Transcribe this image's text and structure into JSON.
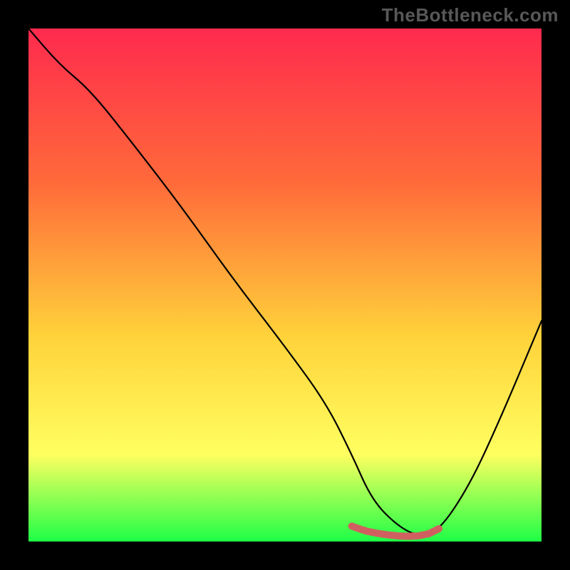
{
  "watermark": "TheBottleneck.com",
  "colors": {
    "frame": "#000000",
    "gradient_top": "#ff2a4e",
    "gradient_mid1": "#ff6a3a",
    "gradient_mid2": "#ffd23a",
    "gradient_mid3": "#ffff60",
    "gradient_bottom": "#1eff46",
    "curve": "#000000",
    "marker": "#d06060"
  },
  "chart_data": {
    "type": "line",
    "title": "",
    "xlabel": "",
    "ylabel": "",
    "xlim": [
      0,
      100
    ],
    "ylim": [
      0,
      100
    ],
    "series": [
      {
        "name": "bottleneck-curve",
        "x": [
          0,
          6,
          12,
          20,
          30,
          40,
          50,
          58,
          63,
          67,
          72,
          76,
          80,
          86,
          92,
          100
        ],
        "y": [
          100,
          93,
          88,
          78,
          65,
          51,
          38,
          27,
          17,
          8,
          3,
          1,
          2,
          11,
          24,
          43
        ]
      }
    ],
    "annotations": [
      {
        "name": "bottleneck-valley-marker",
        "x": [
          63,
          65,
          66,
          68,
          70,
          72,
          74,
          76,
          78,
          80
        ],
        "y": [
          3,
          2.3,
          2.0,
          1.6,
          1.3,
          1.1,
          1.0,
          1.1,
          1.5,
          2.5
        ]
      }
    ]
  }
}
